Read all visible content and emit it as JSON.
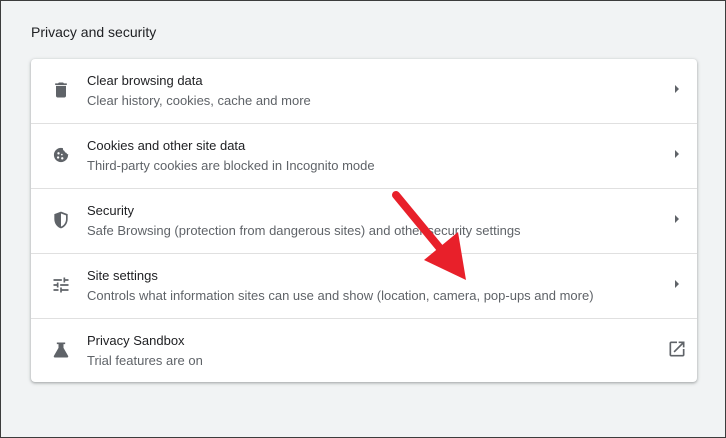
{
  "section": {
    "title": "Privacy and security"
  },
  "rows": [
    {
      "title": "Clear browsing data",
      "subtitle": "Clear history, cookies, cache and more",
      "icon": "trash-icon",
      "trailing": "chevron-right-icon"
    },
    {
      "title": "Cookies and other site data",
      "subtitle": "Third-party cookies are blocked in Incognito mode",
      "icon": "cookie-icon",
      "trailing": "chevron-right-icon"
    },
    {
      "title": "Security",
      "subtitle": "Safe Browsing (protection from dangerous sites) and other security settings",
      "icon": "shield-icon",
      "trailing": "chevron-right-icon"
    },
    {
      "title": "Site settings",
      "subtitle": "Controls what information sites can use and show (location, camera, pop-ups and more)",
      "icon": "tune-sliders-icon",
      "trailing": "chevron-right-icon"
    },
    {
      "title": "Privacy Sandbox",
      "subtitle": "Trial features are on",
      "icon": "flask-icon",
      "trailing": "open-in-new-icon"
    }
  ],
  "colors": {
    "page_background": "#f1f3f4",
    "card_background": "#ffffff",
    "icon": "#5f6368",
    "annotation_arrow": "#e8202a"
  }
}
